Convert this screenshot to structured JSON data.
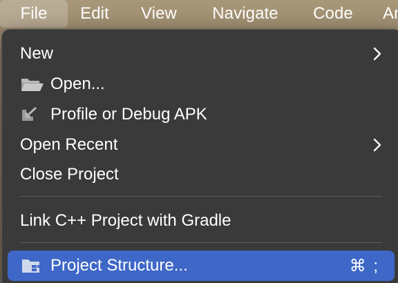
{
  "menubar": {
    "items": [
      {
        "label": "File",
        "active": true
      },
      {
        "label": "Edit"
      },
      {
        "label": "View"
      },
      {
        "label": "Navigate"
      },
      {
        "label": "Code"
      },
      {
        "label": "An"
      }
    ]
  },
  "file_menu": {
    "items": [
      {
        "label": "New",
        "submenu": true
      },
      {
        "label": "Open...",
        "icon": "folder-open-icon"
      },
      {
        "label": "Profile or Debug APK",
        "icon": "import-arrow-icon"
      },
      {
        "label": "Open Recent",
        "submenu": true
      },
      {
        "label": "Close Project"
      },
      {
        "label": "Link C++ Project with Gradle"
      },
      {
        "label": "Project Structure...",
        "icon": "project-structure-icon",
        "shortcut": "⌘ ;",
        "highlighted": true
      }
    ]
  },
  "colors": {
    "menu_background": "#3a3a3a",
    "highlight": "#3e67c7",
    "menubar": "#a89779",
    "text": "#ffffff"
  }
}
